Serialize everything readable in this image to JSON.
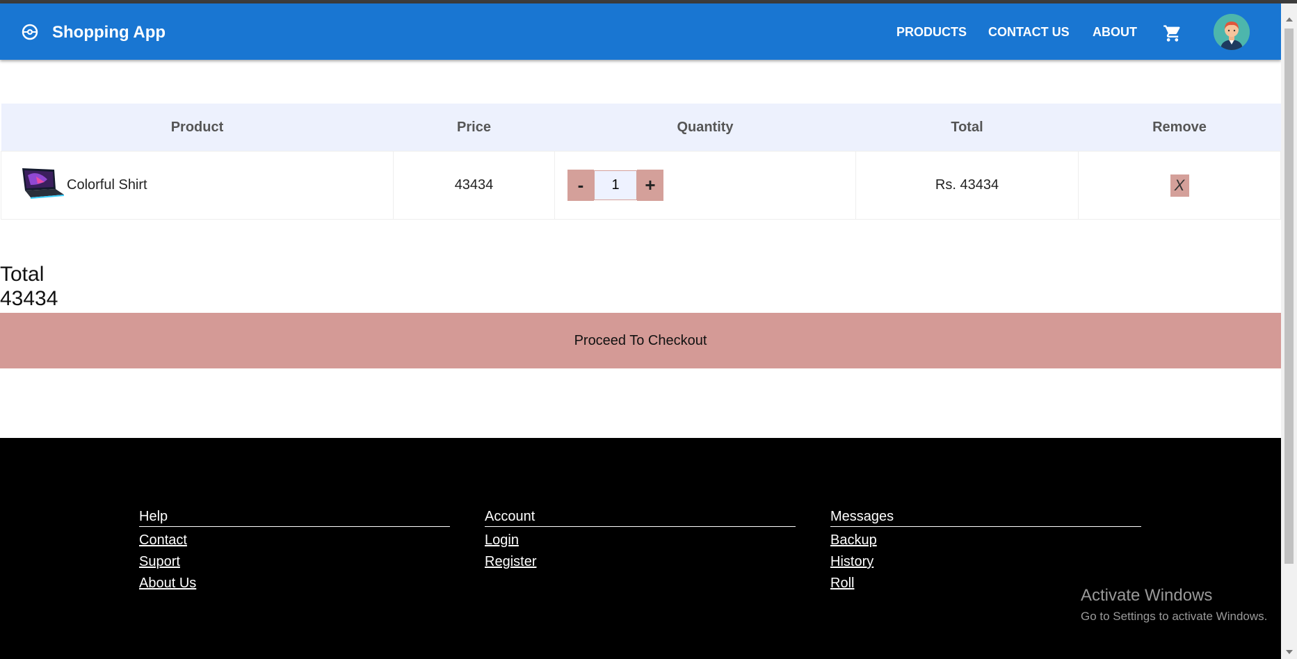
{
  "header": {
    "brand": "Shopping App",
    "nav": [
      "PRODUCTS",
      "CONTACT US",
      "ABOUT"
    ],
    "icons": {
      "brand": "pokeball-icon",
      "cart": "cart-icon",
      "avatar": "user-avatar"
    },
    "colors": {
      "appbar": "#1976d2"
    }
  },
  "cart": {
    "columns": [
      "Product",
      "Price",
      "Quantity",
      "Total",
      "Remove"
    ],
    "rows": [
      {
        "product": "Colorful Shirt",
        "price": "43434",
        "quantity": "1",
        "total": "Rs. 43434",
        "remove": "X",
        "decrement": "-",
        "increment": "+"
      }
    ]
  },
  "summary": {
    "total_label": "Total",
    "total_value": "43434",
    "checkout": "Proceed To Checkout"
  },
  "footer": {
    "columns": [
      {
        "heading": "Help",
        "links": [
          "Contact",
          "Suport",
          "About Us"
        ]
      },
      {
        "heading": "Account",
        "links": [
          "Login",
          "Register"
        ]
      },
      {
        "heading": "Messages",
        "links": [
          "Backup",
          "History",
          "Roll"
        ]
      }
    ]
  },
  "watermark": {
    "line1": "Activate Windows",
    "line2": "Go to Settings to activate Windows."
  },
  "colors": {
    "accent": "#d49a96",
    "table_header": "#edf1fd",
    "footer": "#000000"
  }
}
